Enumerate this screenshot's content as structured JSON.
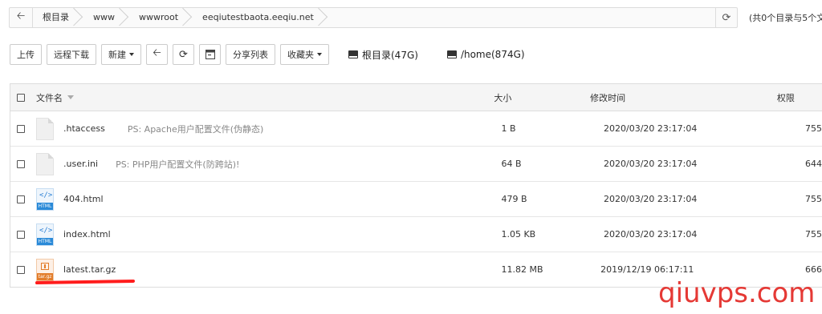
{
  "pathbar": {
    "crumbs": [
      "根目录",
      "www",
      "wwwroot",
      "eeqiutestbaota.eeqiu.net"
    ],
    "summary": "(共0个目录与5个文"
  },
  "toolbar": {
    "upload": "上传",
    "remote_download": "远程下载",
    "new": "新建",
    "share_list": "分享列表",
    "favorites": "收藏夹",
    "disk_root": "根目录(47G)",
    "disk_home": "/home(874G)"
  },
  "table": {
    "headers": {
      "name": "文件名",
      "size": "大小",
      "modified": "修改时间",
      "perm": "权限"
    },
    "rows": [
      {
        "name": ".htaccess",
        "note": "PS: Apache用户配置文件(伪静态)",
        "size": "1 B",
        "time": "2020/03/20 23:17:04",
        "perm": "755",
        "icon": "blank-file-icon"
      },
      {
        "name": ".user.ini",
        "note": "PS: PHP用户配置文件(防跨站)!",
        "size": "64 B",
        "time": "2020/03/20 23:17:04",
        "perm": "644",
        "icon": "blank-file-icon"
      },
      {
        "name": "404.html",
        "note": "",
        "size": "479 B",
        "time": "2020/03/20 23:17:04",
        "perm": "755",
        "icon": "html-file-icon"
      },
      {
        "name": "index.html",
        "note": "",
        "size": "1.05 KB",
        "time": "2020/03/20 23:17:04",
        "perm": "755",
        "icon": "html-file-icon"
      },
      {
        "name": "latest.tar.gz",
        "note": "",
        "size": "11.82 MB",
        "time": "2019/12/19 06:17:11",
        "perm": "666",
        "icon": "archive-file-icon"
      }
    ]
  },
  "icons": {
    "html_band": "HTML",
    "gz_band": "tar.gz"
  },
  "watermark": "qiuvps.com",
  "colors": {
    "annotation_red": "#ff1c1c",
    "watermark_red": "#e53935",
    "html_blue": "#2a8ad8",
    "archive_orange": "#e27c2a"
  }
}
